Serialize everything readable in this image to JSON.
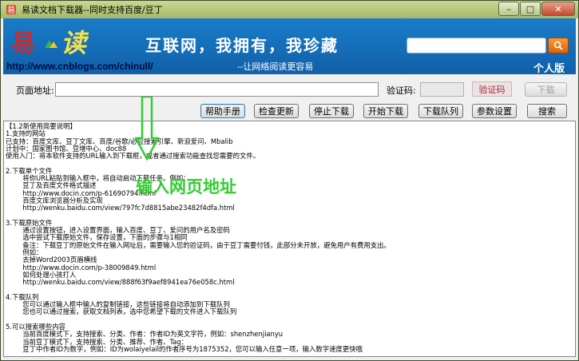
{
  "window": {
    "title": "易读文档下载器--同时支持百度/豆丁",
    "controls": {
      "minimize": "–",
      "maximize": "□",
      "close": "✕"
    }
  },
  "banner": {
    "logo_char1": "易",
    "logo_char2": "读",
    "url": "http://www.cnblogs.com/chinull/",
    "slogan": "互联网，我拥有，我珍藏",
    "subslogan": "--让网络阅读更容易",
    "edition": "个人版",
    "search": {
      "value": "",
      "icon": "search-icon"
    }
  },
  "form": {
    "url_label": "页面地址:",
    "url_value": "",
    "captcha_label": "验证码:",
    "captcha_value": "",
    "captcha_image_text": "验证码",
    "download_button": "下载"
  },
  "toolbar": {
    "help": "帮助手册",
    "update": "检查更新",
    "stop": "停止下载",
    "start": "开始下载",
    "queue": "下载队列",
    "settings": "参数设置",
    "search": "搜索"
  },
  "content_lines": [
    "【1.2新使用简要说明】",
    "1.支持的网站",
    "已支持：百度文库、豆丁文库、百度/谷歌/必应搜索引擎、新浪爱问、Mbalib",
    "计划中：国家图书馆、豆增中心、doc88",
    "使用入门：将本软件支持的URL输入到下载框，或者通过搜索功能查找您需要的文件。",
    "",
    "2.下载单个文件",
    "        将你URL粘贴到输入框中，将自动启动下载任务。例如：",
    "        豆丁及百度文件格式描述",
    "        http://www.docin.com/p-61690794.html",
    "        百度文库浏览器分析及实现",
    "        http://wenku.baidu.com/view/797fc7d8815abe23482f4dfa.html",
    "",
    "3.下载原始文件",
    "        通过设置按钮，进入设置界面，输入百度、豆丁、爱问的用户名及密码",
    "        选中尝试下载原始文件，保存设置，下面的步骤与1相同",
    "        备注：下载豆丁的原始文件在输入网址后，需要输入您的验证码，由于豆丁需要付钱，此部分未开放，避免用户有费用支出。",
    "        例如：",
    "        去掉Word2003页眉横线",
    "        http://www.docin.com/p-38009849.html",
    "        如何处理小孩打人",
    "        http://wenku.baidu.com/view/888f63f9aef8941ea76e058c.html",
    "",
    "4.下载队列",
    "        您可以通过输入框中输入的复制链接，这些链接将自动添加到下载队列",
    "        您也可以通过搜索，获取文档列表，选中您希望下载的文件进入下载队列",
    "",
    "5.可以搜索哪些内容",
    "        当前百度模式下，支持搜索、分类、作者：作者ID为英文字符，例如：shenzhenjianyu",
    "        当前豆丁模式下，支持搜索、分类、推荐、作者、Tag：",
    "        豆丁中作者ID为数字，例如：ID为wolaiyelail的作者序号为1875352，您可以输入任意一项，输入数字速度更快哦"
  ],
  "overlay": {
    "label": "输入网页地址"
  },
  "colors": {
    "banner": "#1a7cc9",
    "overlay": "#33cc33",
    "search_button": "#f79a3a"
  }
}
